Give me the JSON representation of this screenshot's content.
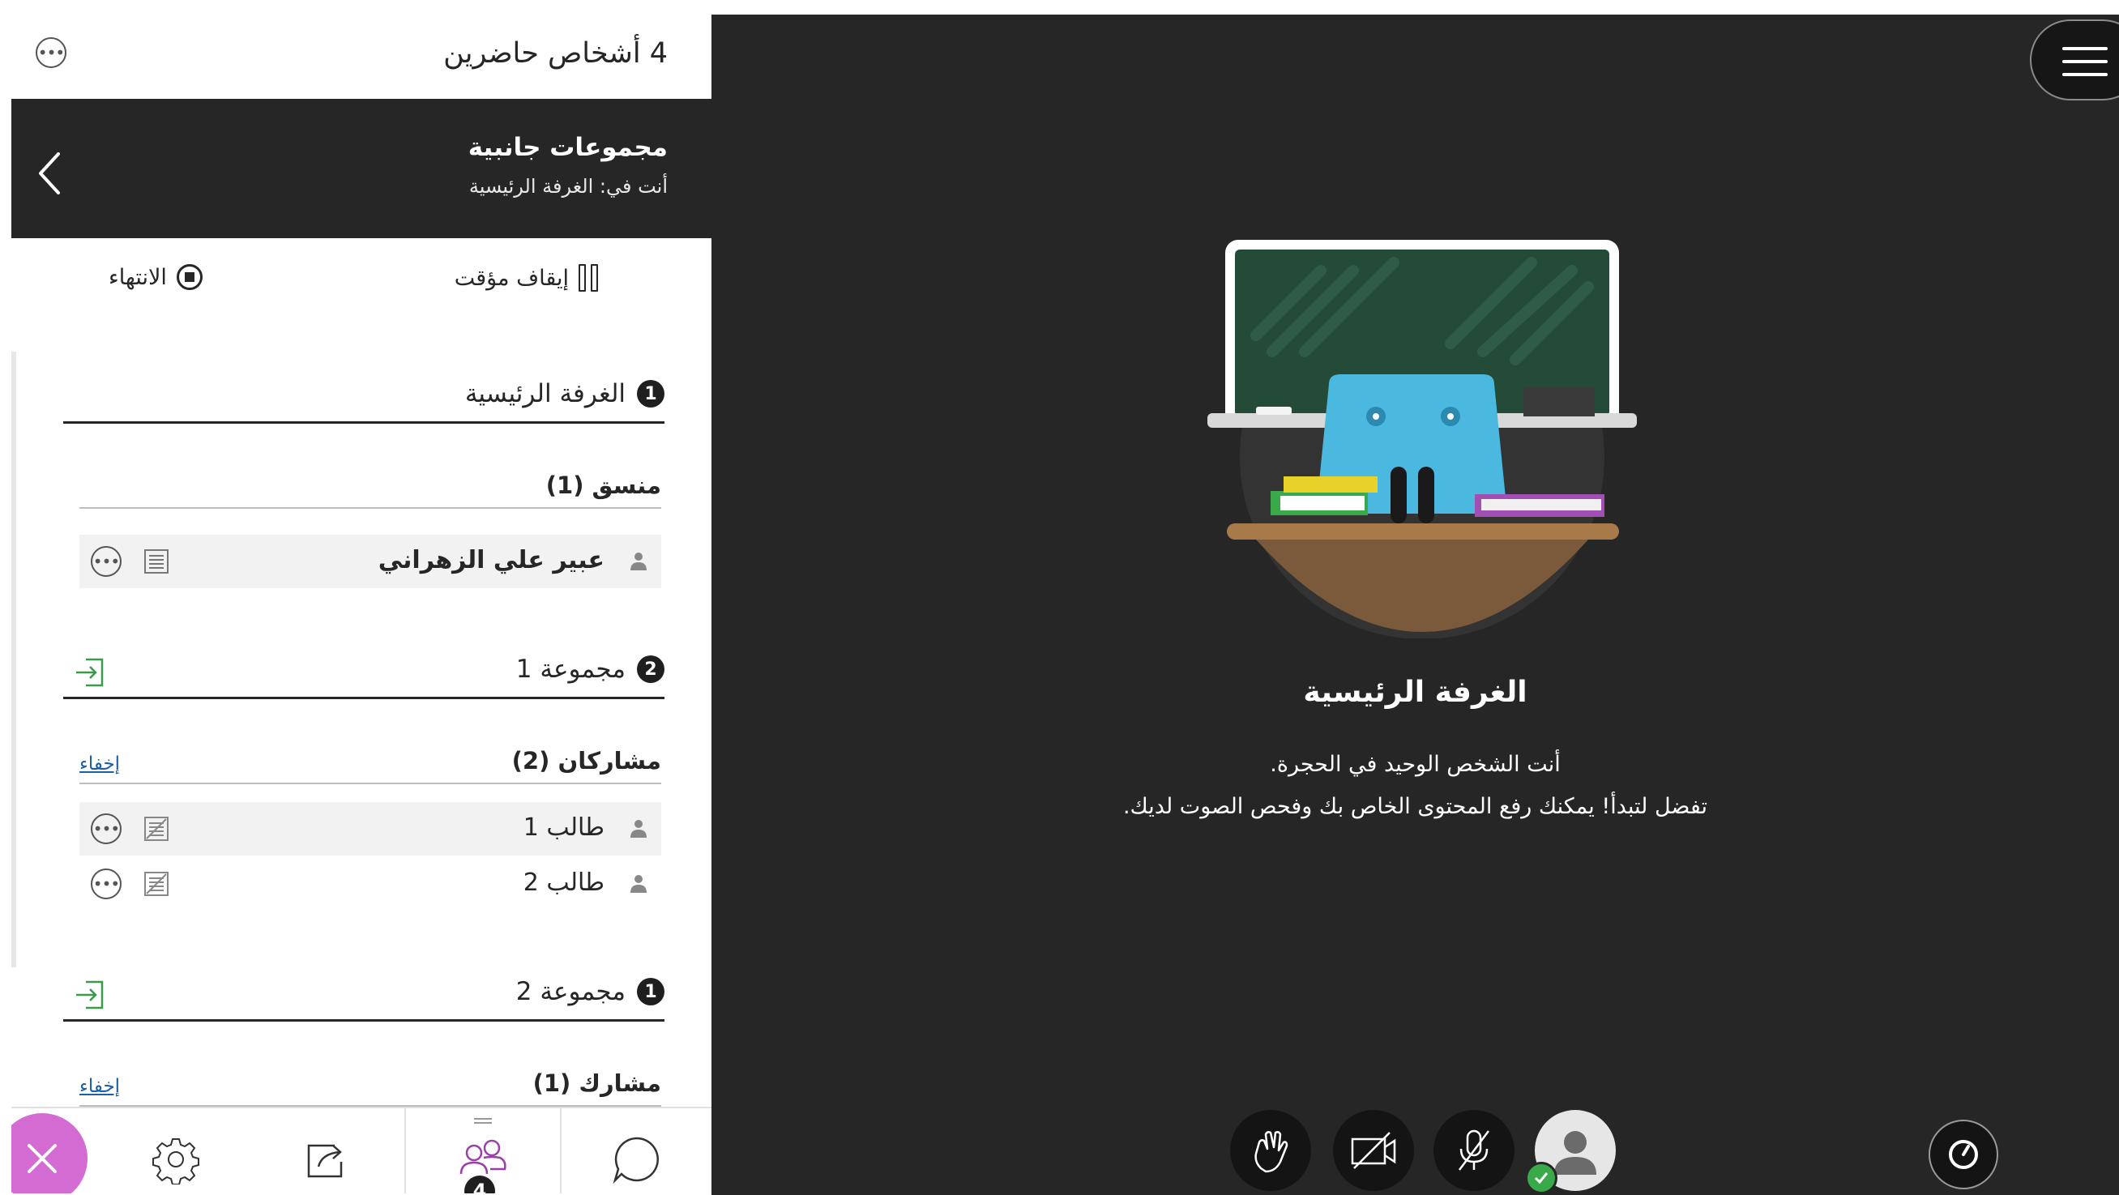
{
  "panel": {
    "header_title": "4 أشخاص حاضرين",
    "breakout": {
      "title": "مجموعات جانبية",
      "subtitle": "أنت في: الغرفة الرئيسية"
    },
    "actions": {
      "pause_label": "إيقاف مؤقت",
      "end_label": "الانتهاء"
    },
    "groups": [
      {
        "badge": "1",
        "name": "الغرفة الرئيسية",
        "roles": [
          {
            "label": "منسق (1)",
            "people": [
              {
                "name": "عبير علي الزهراني"
              }
            ]
          }
        ]
      },
      {
        "badge": "2",
        "name": "مجموعة 1",
        "roles": [
          {
            "label": "مشاركان (2)",
            "hide_label": "إخفاء",
            "people": [
              {
                "name": "طالب 1"
              },
              {
                "name": "طالب 2"
              }
            ]
          }
        ]
      },
      {
        "badge": "1",
        "name": "مجموعة 2",
        "roles": [
          {
            "label": "مشارك (1)",
            "hide_label": "إخفاء"
          }
        ]
      }
    ],
    "toolbar": {
      "attendee_count": "4",
      "close_color": "#d36bd3"
    }
  },
  "stage": {
    "room_title": "الغرفة الرئيسية",
    "message_line1": "أنت الشخص الوحيد في الحجرة.",
    "message_line2": "تفضل لتبدأ! يمكنك رفع المحتوى الخاص بك وفحص الصوت لديك.",
    "background_color": "#262626",
    "status_color": "#3aa94a"
  }
}
